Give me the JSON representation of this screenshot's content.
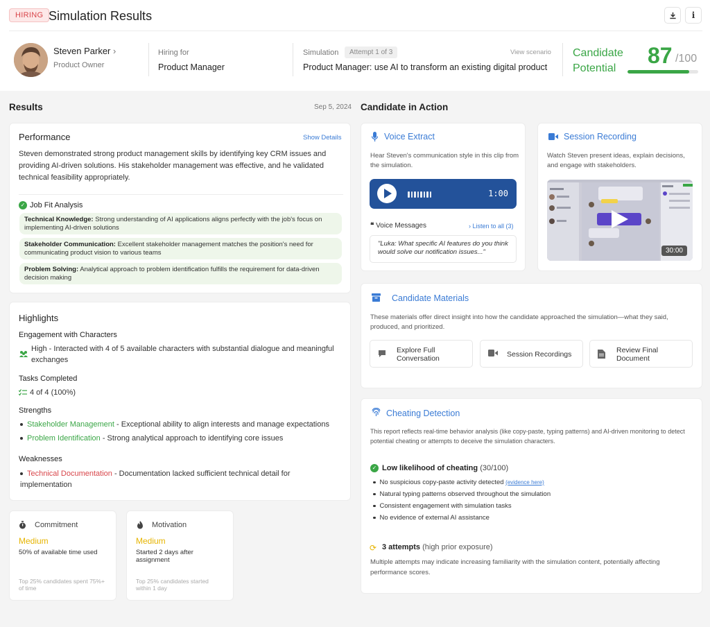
{
  "header": {
    "badge": "HIRING",
    "title": "Simulation Results",
    "download_icon": "download-icon",
    "info_icon": "info-icon"
  },
  "candidate": {
    "name": "Steven Parker",
    "chevron": "›",
    "role": "Product Owner",
    "hiring_for_label": "Hiring for",
    "hiring_for_value": "Product Manager",
    "simulation_label": "Simulation",
    "attempt": "Attempt 1 of 3",
    "view_scenario": "View scenario",
    "simulation_value": "Product Manager: use AI to transform an existing digital product",
    "potential_label": "Candidate Potential",
    "potential_label_line1": "Candidate",
    "potential_label_line2": "Potential",
    "score": "87",
    "score_den": "/100",
    "score_fraction": 0.87,
    "accent_color": "#3aa646"
  },
  "results": {
    "title": "Results",
    "date": "Sep 5, 2024",
    "performance": {
      "title": "Performance",
      "show_details": "Show Details",
      "summary": "Steven demonstrated strong product management skills by identifying key CRM issues and providing AI-driven solutions. His stakeholder management was effective, and he validated technical feasibility appropriately.",
      "job_fit_title": "Job Fit Analysis",
      "job_fit": [
        {
          "label": "Technical Knowledge:",
          "text": " Strong understanding of AI applications aligns perfectly with the job's focus on implementing AI-driven solutions"
        },
        {
          "label": "Stakeholder Communication:",
          "text": " Excellent stakeholder management matches the position's need for communicating product vision to various teams"
        },
        {
          "label": "Problem Solving:",
          "text": " Analytical approach to problem identification fulfills the requirement for data-driven decision making"
        }
      ]
    },
    "highlights": {
      "title": "Highlights",
      "engagement_title": "Engagement with Characters",
      "engagement_text": "High - Interacted with 4 of 5 available characters with substantial dialogue and meaningful exchanges",
      "tasks_title": "Tasks Completed",
      "tasks_value": "4 of 4 (100%)",
      "strengths_title": "Strengths",
      "strengths": [
        {
          "name": "Stakeholder Management",
          "text": " - Exceptional ability to align interests and manage expectations"
        },
        {
          "name": "Problem Identification",
          "text": " - Strong analytical approach to identifying core issues"
        }
      ],
      "weaknesses_title": "Weaknesses",
      "weaknesses": [
        {
          "name": "Technical Documentation",
          "text": " - Documentation lacked sufficient technical detail for implementation"
        }
      ]
    },
    "commitment": {
      "title": "Commitment",
      "level": "Medium",
      "desc": "50% of available time used",
      "footnote": "Top 25% candidates spent 75%+ of time"
    },
    "motivation": {
      "title": "Motivation",
      "level": "Medium",
      "desc": "Started 2 days after assignment",
      "footnote": "Top 25% candidates started within 1 day"
    }
  },
  "action": {
    "title": "Candidate in Action",
    "voice": {
      "title": "Voice Extract",
      "desc": "Hear Steven's communication style in this clip from the simulation.",
      "duration": "1:00",
      "messages_label": "Voice Messages",
      "listen_all": "Listen to all (3)",
      "quote": "\"Luka: What specific AI features do you think would solve our notification issues...\""
    },
    "session": {
      "title": "Session Recording",
      "desc": "Watch Steven present ideas, explain decisions, and engage with stakeholders.",
      "duration": "30:00"
    },
    "materials": {
      "title": "Candidate Materials",
      "desc": "These materials offer direct insight into how the candidate approached the simulation—what they said, produced, and prioritized.",
      "buttons": [
        {
          "label": "Explore Full Conversation",
          "line1": "Explore Full",
          "line2": "Conversation"
        },
        {
          "label": "Session Recordings"
        },
        {
          "label": "Review Final Document",
          "line1": "Review Final",
          "line2": "Document"
        }
      ]
    },
    "cheating": {
      "title": "Cheating Detection",
      "desc": "This report reflects real-time behavior analysis (like copy-paste, typing patterns) and AI-driven monitoring to detect potential cheating or attempts to deceive the simulation characters.",
      "likelihood": "Low likelihood of cheating",
      "likelihood_score": "(30/100)",
      "items": [
        "No suspicious copy-paste activity detected",
        "Natural typing patterns observed throughout the simulation",
        "Consistent engagement with simulation tasks",
        "No evidence of external AI assistance"
      ],
      "evidence_link": "(evidence here)",
      "attempts": "3 attempts",
      "attempts_note": "(high prior exposure)",
      "attempts_desc": "Multiple attempts may indicate increasing familiarity with the simulation content, potentially affecting performance scores."
    }
  }
}
